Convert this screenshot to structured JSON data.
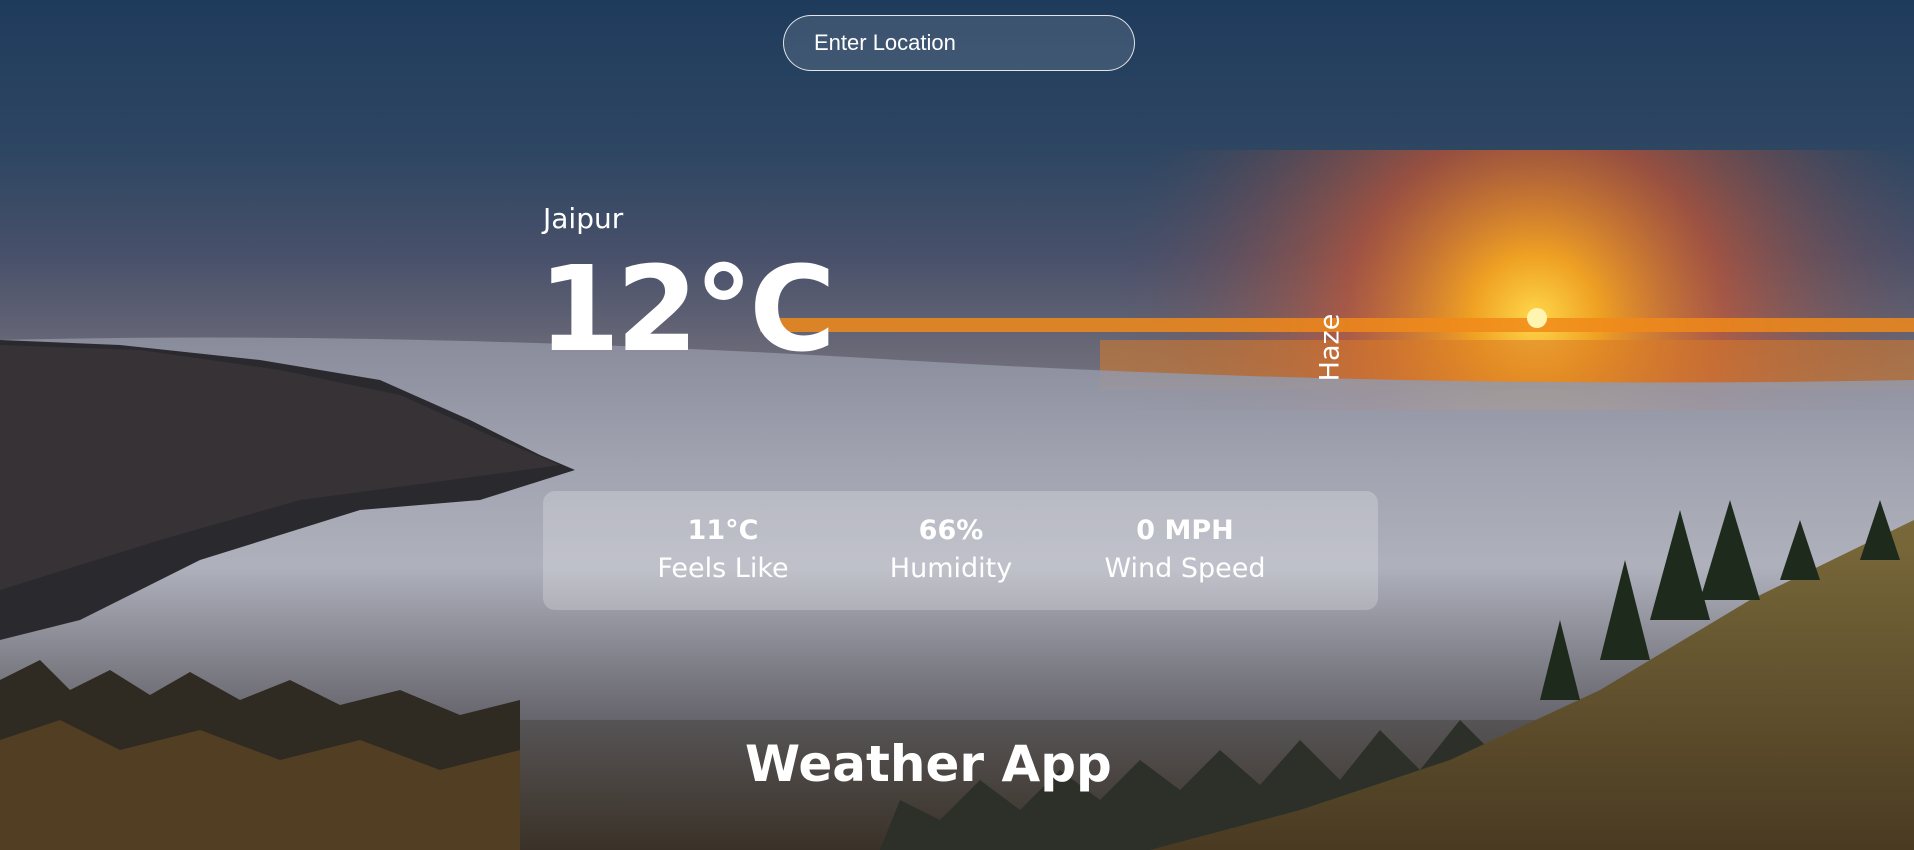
{
  "search": {
    "placeholder": "Enter Location",
    "value": ""
  },
  "weather": {
    "city": "Jaipur",
    "temperature": "12°C",
    "condition": "Haze"
  },
  "stats": [
    {
      "value": "11°C",
      "label": "Feels Like"
    },
    {
      "value": "66%",
      "label": "Humidity"
    },
    {
      "value": "0 MPH",
      "label": "Wind Speed"
    }
  ],
  "app_title": "Weather App",
  "colors": {
    "text": "#ffffff",
    "panel": "rgba(255,255,255,0.22)",
    "sky_top": "#1f3b5c",
    "sunset": "#f39a1e"
  }
}
